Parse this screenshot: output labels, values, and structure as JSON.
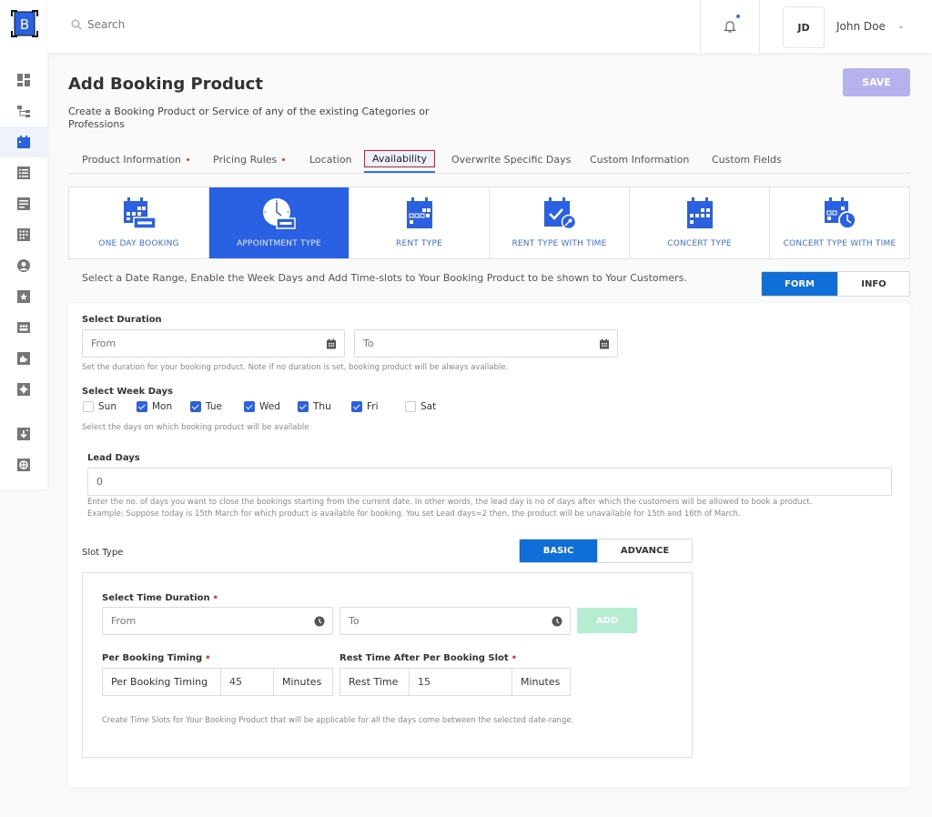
{
  "app": {
    "logo_letter": "B"
  },
  "sidebar": {
    "items": [
      {
        "name": "dashboard",
        "icon": "dashboard-icon",
        "active": false
      },
      {
        "name": "hierarchy",
        "icon": "hierarchy-icon",
        "active": false
      },
      {
        "name": "booking-calendar",
        "icon": "calendar-icon",
        "active": true
      },
      {
        "name": "list",
        "icon": "list-icon",
        "active": false
      },
      {
        "name": "document",
        "icon": "document-icon",
        "active": false
      },
      {
        "name": "grid",
        "icon": "grid-icon",
        "active": false
      },
      {
        "name": "user",
        "icon": "user-icon",
        "active": false
      },
      {
        "name": "favorites",
        "icon": "star-icon",
        "active": false
      },
      {
        "name": "team",
        "icon": "team-icon",
        "active": false
      },
      {
        "name": "plugins",
        "icon": "puzzle-icon",
        "active": false
      },
      {
        "name": "settings",
        "icon": "gear-icon",
        "active": false
      },
      {
        "name": "import",
        "icon": "download-icon",
        "active": false
      },
      {
        "name": "support",
        "icon": "lifebuoy-icon",
        "active": false
      }
    ]
  },
  "header": {
    "search_placeholder": "Search",
    "notification_badge": true,
    "user_initials": "JD",
    "user_name": "John Doe"
  },
  "page": {
    "title": "Add Booking Product",
    "subtitle": "Create a Booking Product or Service of any of the existing Categories or Professions",
    "save_label": "SAVE"
  },
  "tabs": [
    {
      "label": "Product Information",
      "required": true,
      "active": false
    },
    {
      "label": "Pricing Rules",
      "required": true,
      "active": false
    },
    {
      "label": "Location",
      "required": false,
      "active": false
    },
    {
      "label": "Availability",
      "required": false,
      "active": true
    },
    {
      "label": "Overwrite Specific Days",
      "required": false,
      "active": false
    },
    {
      "label": "Custom Information",
      "required": false,
      "active": false
    },
    {
      "label": "Custom Fields",
      "required": false,
      "active": false
    }
  ],
  "booking_types": [
    {
      "label": "ONE DAY BOOKING",
      "icon": "calendar-card-icon",
      "active": false
    },
    {
      "label": "APPOINTMENT TYPE",
      "icon": "clock-card-icon",
      "active": true
    },
    {
      "label": "RENT TYPE",
      "icon": "calendar-grid-icon",
      "active": false
    },
    {
      "label": "RENT TYPE WITH TIME",
      "icon": "calendar-check-key-icon",
      "active": false
    },
    {
      "label": "CONCERT TYPE",
      "icon": "calendar-grid-icon",
      "active": false
    },
    {
      "label": "CONCERT TYPE WITH TIME",
      "icon": "calendar-clock-icon",
      "active": false
    }
  ],
  "instructions": "Select a Date Range, Enable the Week Days and Add Time-slots to Your Booking Product to be shown to Your Customers.",
  "view_toggle": {
    "form": "FORM",
    "info": "INFO",
    "selected": "FORM"
  },
  "form": {
    "duration": {
      "label": "Select Duration",
      "from_placeholder": "From",
      "to_placeholder": "To",
      "help": "Set the duration for your booking product. Note if no duration is set, booking product will be always available."
    },
    "week_days": {
      "label": "Select Week Days",
      "days": [
        {
          "label": "Sun",
          "checked": false
        },
        {
          "label": "Mon",
          "checked": true
        },
        {
          "label": "Tue",
          "checked": true
        },
        {
          "label": "Wed",
          "checked": true
        },
        {
          "label": "Thu",
          "checked": true
        },
        {
          "label": "Fri",
          "checked": true
        },
        {
          "label": "Sat",
          "checked": false
        }
      ],
      "help": "Select the days on which booking product will be available"
    },
    "lead_days": {
      "label": "Lead Days",
      "value": "0",
      "help_line1": "Enter the no. of days you want to close the bookings starting from the current date. In other words, the lead day is no of days after which the customers will be allowed to book a product.",
      "help_line2": "Example: Suppose today is 15th March for which product is available for booking. You set Lead days=2 then, the product will be unavailable for 15th and 16th of March."
    },
    "slot_type": {
      "label": "Slot Type",
      "basic": "BASIC",
      "advance": "ADVANCE",
      "selected": "BASIC"
    },
    "time_duration": {
      "label": "Select Time Duration",
      "from_placeholder": "From",
      "to_placeholder": "To",
      "add_label": "ADD"
    },
    "per_booking": {
      "label": "Per Booking Timing",
      "prefix": "Per Booking Timing",
      "value": "45",
      "suffix": "Minutes"
    },
    "rest_time": {
      "label": "Rest Time After Per Booking Slot",
      "prefix": "Rest Time",
      "value": "15",
      "suffix": "Minutes"
    },
    "slots_help": "Create Time Slots for Your Booking Product that will be applicable for all the days come between the selected date-range."
  }
}
